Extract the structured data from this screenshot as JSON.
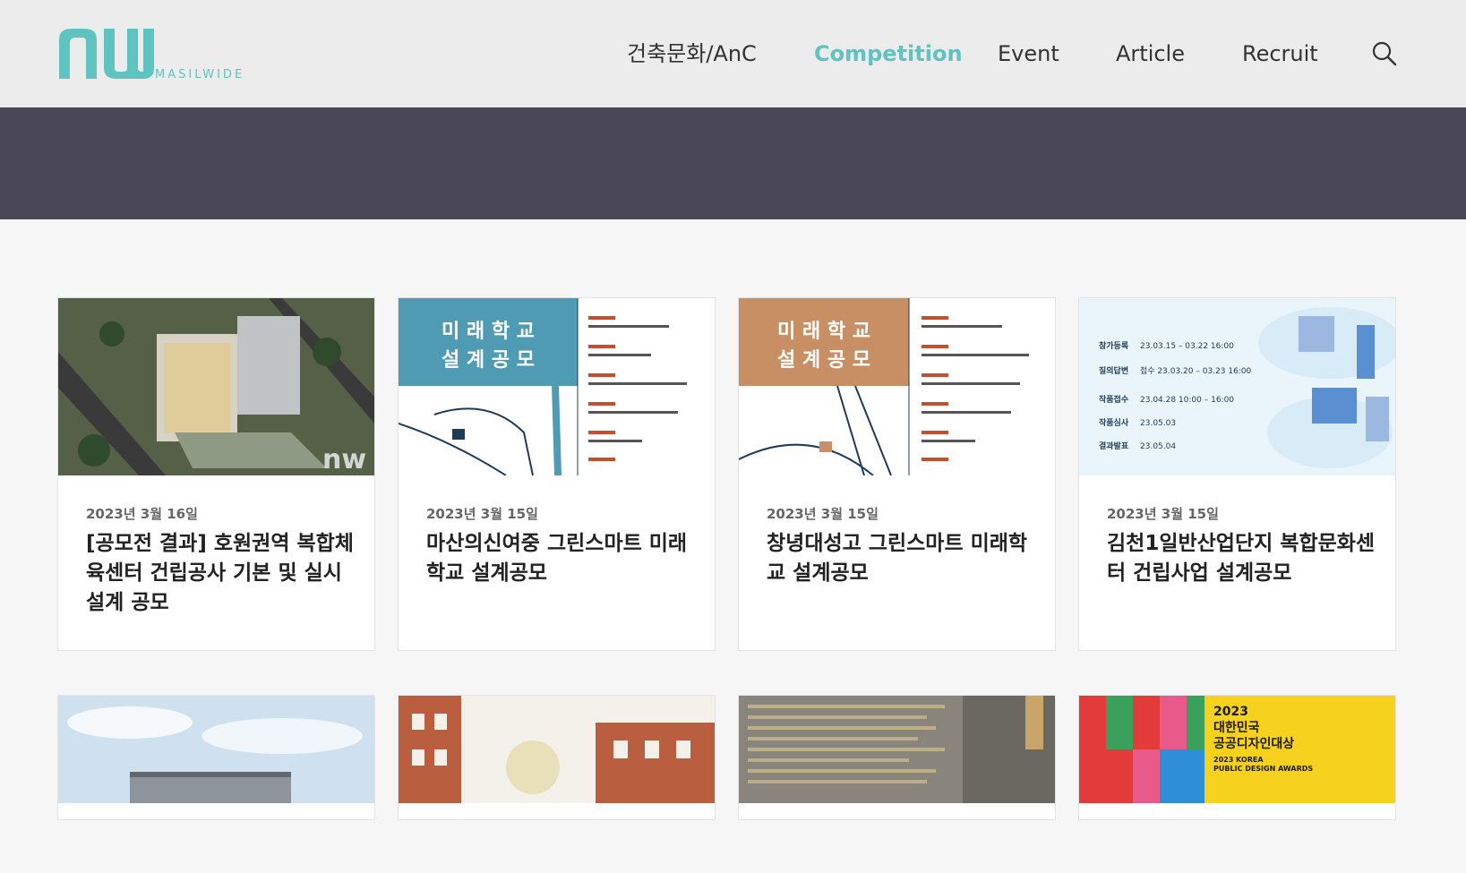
{
  "header": {
    "logo_text": "MASILWIDE",
    "nav": [
      {
        "label": "건축문화/AnC",
        "active": false
      },
      {
        "label": "Competition",
        "active": true
      },
      {
        "label": "Event",
        "active": false
      },
      {
        "label": "Article",
        "active": false
      },
      {
        "label": "Recruit",
        "active": false
      }
    ],
    "search_icon": "search-icon"
  },
  "colors": {
    "accent": "#5fc4c0",
    "banner": "#4a4857",
    "header_bg": "#ececec",
    "page_bg": "#f6f6f6"
  },
  "cards": [
    {
      "date": "2023년 3월 16일",
      "title": "[공모전 결과] 호원권역 복합체육센터 건립공사 기본 및 실시설계 공모"
    },
    {
      "date": "2023년 3월 15일",
      "title": "마산의신여중 그린스마트 미래학교 설계공모"
    },
    {
      "date": "2023년 3월 15일",
      "title": "창녕대성고 그린스마트 미래학교 설계공모"
    },
    {
      "date": "2023년 3월 15일",
      "title": "김천1일반산업단지 복합문화센터 건립사업 설계공모"
    }
  ],
  "thumb_text": {
    "poster1_lines": [
      "미 래 학 교",
      "설 계 공 모"
    ],
    "poster2_lines": [
      "미 래 학 교",
      "설 계 공 모"
    ],
    "poster4_rows": [
      {
        "label": "참가등록",
        "value": "23.03.15 – 03.22 16:00"
      },
      {
        "label": "질의답변",
        "value": "접수 23.03.20 – 03.23 16:00"
      },
      {
        "label": "작품접수",
        "value": "23.04.28 10:00 – 16:00"
      },
      {
        "label": "작품심사",
        "value": "23.05.03"
      },
      {
        "label": "결과발표",
        "value": "23.05.04"
      }
    ],
    "award_lines": [
      "2023",
      "대한민국",
      "공공디자인대상",
      "2023 KOREA",
      "PUBLIC DESIGN AWARDS"
    ]
  }
}
